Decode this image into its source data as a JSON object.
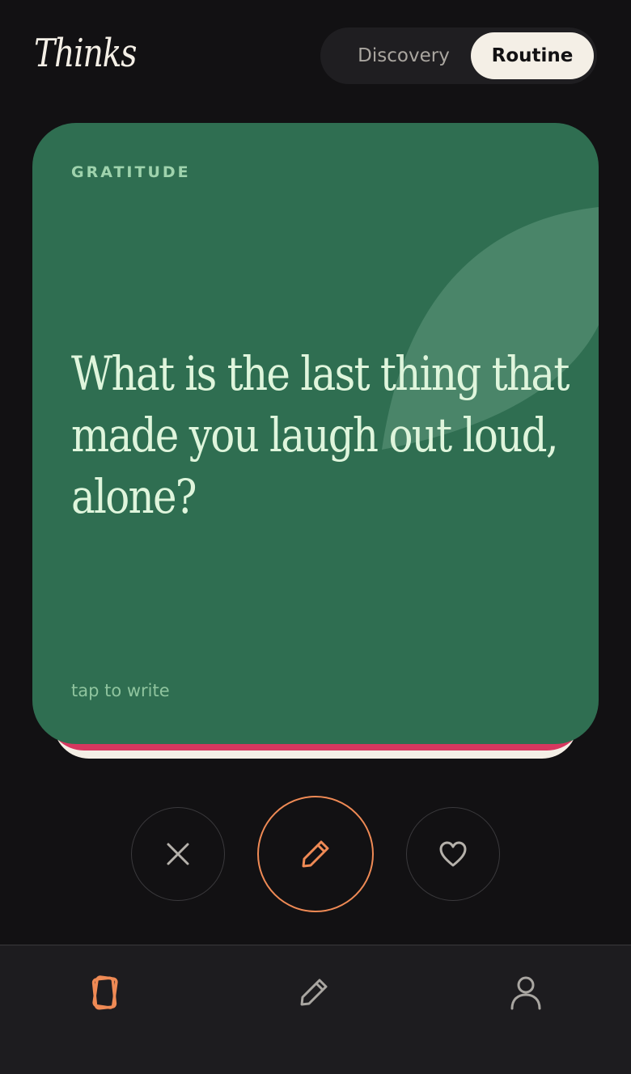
{
  "app": {
    "title": "Thinks"
  },
  "mode_toggle": {
    "options": [
      "Discovery",
      "Routine"
    ],
    "selected": "Routine"
  },
  "card": {
    "category": "GRATITUDE",
    "question": "What is the last thing that made you laugh out loud, alone?",
    "hint": "tap to write"
  },
  "actions": {
    "skip_icon": "close-icon",
    "write_icon": "pencil-icon",
    "like_icon": "heart-icon"
  },
  "bottom_nav": {
    "items": [
      {
        "icon": "cards-icon",
        "active": true
      },
      {
        "icon": "pencil-icon",
        "active": false
      },
      {
        "icon": "user-icon",
        "active": false
      }
    ]
  },
  "colors": {
    "background": "#121113",
    "card": "#2f6e51",
    "accent": "#ef8a55",
    "stack_pink": "#d7375f",
    "toggle_selected": "#f4efe6"
  }
}
